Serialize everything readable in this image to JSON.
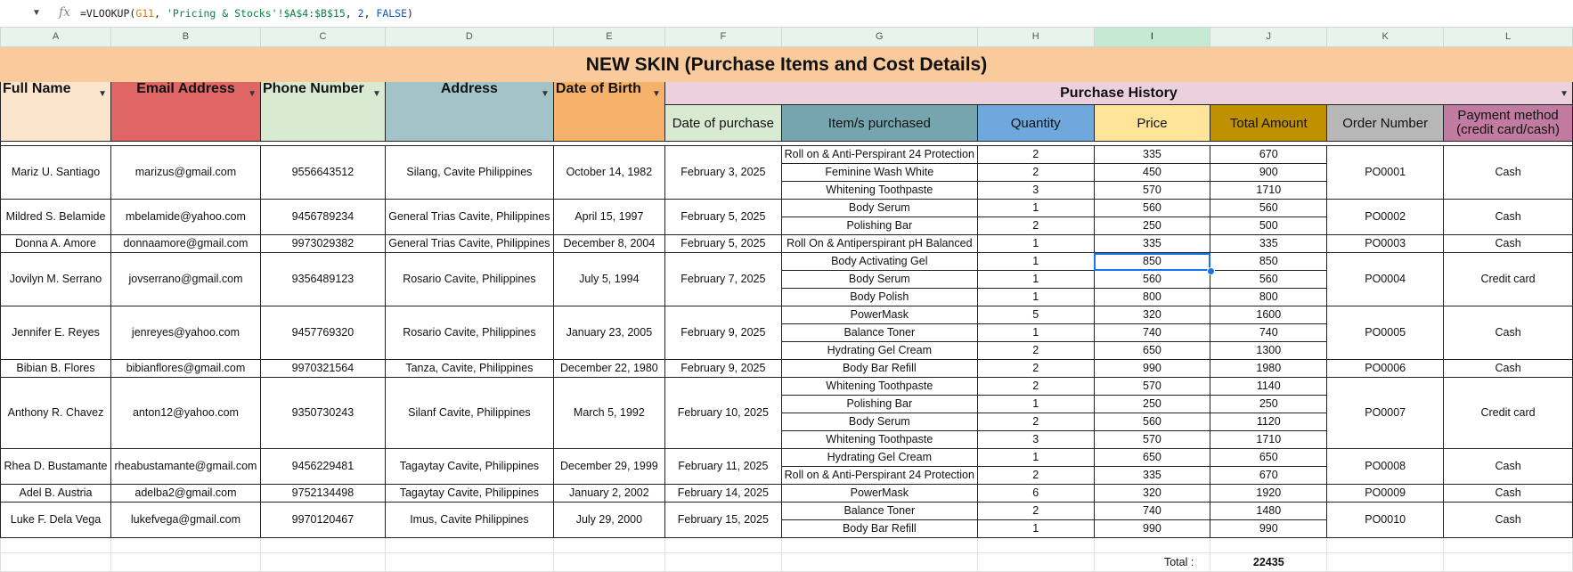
{
  "formula_bar": {
    "fx_label": "fx",
    "parts": [
      "=VLOOKUP(",
      "G11",
      ", ",
      "'Pricing & Stocks'!$A$4:$B$15",
      ", ",
      "2",
      ", ",
      "FALSE",
      ")"
    ]
  },
  "columns": [
    "A",
    "B",
    "C",
    "D",
    "E",
    "F",
    "G",
    "H",
    "I",
    "J",
    "K",
    "L"
  ],
  "selected_column": "I",
  "title": "NEW SKIN (Purchase Items and Cost Details)",
  "headers": {
    "full_name": "Full Name",
    "email": "Email Address",
    "phone": "Phone Number",
    "address": "Address",
    "dob": "Date of Birth",
    "purchase_history": "Purchase History",
    "date_of_purchase": "Date of purchase",
    "items": "Item/s purchased",
    "quantity": "Quantity",
    "price": "Price",
    "total_amount": "Total Amount",
    "order_number": "Order Number",
    "payment_method": "Payment method (credit card/cash)"
  },
  "customers": [
    {
      "name": "Mariz U. Santiago",
      "email": "marizus@gmail.com",
      "phone": "9556643512",
      "address": "Silang, Cavite Philippines",
      "dob": "October 14, 1982",
      "purchase_date": "February 3, 2025",
      "order": "PO0001",
      "payment": "Cash",
      "items": [
        {
          "item": "Roll on & Anti-Perspirant 24 Protection",
          "qty": "2",
          "price": "335",
          "total": "670"
        },
        {
          "item": "Feminine Wash White",
          "qty": "2",
          "price": "450",
          "total": "900"
        },
        {
          "item": "Whitening Toothpaste",
          "qty": "3",
          "price": "570",
          "total": "1710"
        }
      ]
    },
    {
      "name": "Mildred S. Belamide",
      "email": "mbelamide@yahoo.com",
      "phone": "9456789234",
      "address": "General Trias Cavite, Philippines",
      "dob": "April 15, 1997",
      "purchase_date": "February 5, 2025",
      "order": "PO0002",
      "payment": "Cash",
      "items": [
        {
          "item": "Body Serum",
          "qty": "1",
          "price": "560",
          "total": "560"
        },
        {
          "item": "Polishing Bar",
          "qty": "2",
          "price": "250",
          "total": "500"
        }
      ]
    },
    {
      "name": "Donna A. Amore",
      "email": "donnaamore@gmail.com",
      "phone": "9973029382",
      "address": "General Trias Cavite, Philippines",
      "dob": "December 8, 2004",
      "purchase_date": "February 5, 2025",
      "order": "PO0003",
      "payment": "Cash",
      "items": [
        {
          "item": "Roll On & Antiperspirant pH Balanced",
          "qty": "1",
          "price": "335",
          "total": "335"
        }
      ]
    },
    {
      "name": "Jovilyn M. Serrano",
      "email": "jovserrano@gmail.com",
      "phone": "9356489123",
      "address": "Rosario Cavite, Philippines",
      "dob": "July 5, 1994",
      "purchase_date": "February 7, 2025",
      "order": "PO0004",
      "payment": "Credit card",
      "items": [
        {
          "item": "Body Activating Gel",
          "qty": "1",
          "price": "850",
          "total": "850"
        },
        {
          "item": "Body Serum",
          "qty": "1",
          "price": "560",
          "total": "560"
        },
        {
          "item": "Body Polish",
          "qty": "1",
          "price": "800",
          "total": "800"
        }
      ]
    },
    {
      "name": "Jennifer E. Reyes",
      "email": "jenreyes@yahoo.com",
      "phone": "9457769320",
      "address": "Rosario Cavite, Philippines",
      "dob": "January 23, 2005",
      "purchase_date": "February 9, 2025",
      "order": "PO0005",
      "payment": "Cash",
      "items": [
        {
          "item": "PowerMask",
          "qty": "5",
          "price": "320",
          "total": "1600"
        },
        {
          "item": "Balance Toner",
          "qty": "1",
          "price": "740",
          "total": "740"
        },
        {
          "item": "Hydrating Gel Cream",
          "qty": "2",
          "price": "650",
          "total": "1300"
        }
      ]
    },
    {
      "name": "Bibian B. Flores",
      "email": "bibianflores@gmail.com",
      "phone": "9970321564",
      "address": "Tanza, Cavite, Philippines",
      "dob": "December 22, 1980",
      "purchase_date": "February 9, 2025",
      "order": "PO0006",
      "payment": "Cash",
      "items": [
        {
          "item": "Body Bar Refill",
          "qty": "2",
          "price": "990",
          "total": "1980"
        }
      ]
    },
    {
      "name": "Anthony R. Chavez",
      "email": "anton12@yahoo.com",
      "phone": "9350730243",
      "address": "Silanf Cavite, Philippines",
      "dob": "March 5, 1992",
      "purchase_date": "February 10, 2025",
      "order": "PO0007",
      "payment": "Credit card",
      "items": [
        {
          "item": "Whitening Toothpaste",
          "qty": "2",
          "price": "570",
          "total": "1140"
        },
        {
          "item": "Polishing Bar",
          "qty": "1",
          "price": "250",
          "total": "250"
        },
        {
          "item": "Body Serum",
          "qty": "2",
          "price": "560",
          "total": "1120"
        },
        {
          "item": "Whitening Toothpaste",
          "qty": "3",
          "price": "570",
          "total": "1710"
        }
      ]
    },
    {
      "name": "Rhea D. Bustamante",
      "email": "rheabustamante@gmail.com",
      "phone": "9456229481",
      "address": "Tagaytay Cavite, Philippines",
      "dob": "December 29, 1999",
      "purchase_date": "February 11, 2025",
      "order": "PO0008",
      "payment": "Cash",
      "items": [
        {
          "item": "Hydrating Gel Cream",
          "qty": "1",
          "price": "650",
          "total": "650"
        },
        {
          "item": "Roll on & Anti-Perspirant 24 Protection",
          "qty": "2",
          "price": "335",
          "total": "670"
        }
      ]
    },
    {
      "name": "Adel B. Austria",
      "email": "adelba2@gmail.com",
      "phone": "9752134498",
      "address": "Tagaytay Cavite, Philippines",
      "dob": "January 2, 2002",
      "purchase_date": "February 14, 2025",
      "order": "PO0009",
      "payment": "Cash",
      "items": [
        {
          "item": "PowerMask",
          "qty": "6",
          "price": "320",
          "total": "1920"
        }
      ]
    },
    {
      "name": "Luke F. Dela Vega",
      "email": "lukefvega@gmail.com",
      "phone": "9970120467",
      "address": "Imus, Cavite Philippines",
      "dob": "July 29, 2000",
      "purchase_date": "February 15, 2025",
      "order": "PO0010",
      "payment": "Cash",
      "items": [
        {
          "item": "Balance Toner",
          "qty": "2",
          "price": "740",
          "total": "1480"
        },
        {
          "item": "Body Bar Refill",
          "qty": "1",
          "price": "990",
          "total": "990"
        }
      ]
    }
  ],
  "totals": {
    "label": "Total :",
    "value": "22435"
  }
}
